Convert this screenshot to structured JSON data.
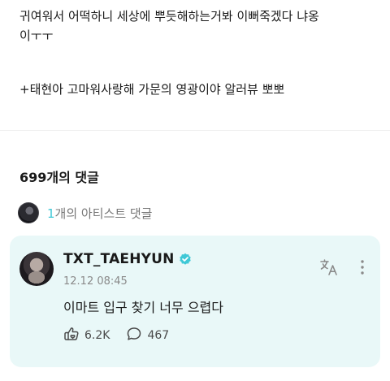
{
  "post": {
    "line1": "귀여워서 어떡하니 세상에 뿌듯해하는거봐 이뻐죽겠다 냐옹",
    "line2": "이ㅜㅜ",
    "addendum": "+태현아 고마워사랑해 가문의 영광이야 알러뷰 뽀뽀"
  },
  "comments": {
    "header": "699개의 댓글"
  },
  "artist_row": {
    "count": "1",
    "label": "개의 아티스트 댓글"
  },
  "artist_comment": {
    "name": "TXT_TAEHYUN",
    "timestamp": "12.12 08:45",
    "text": "이마트 입구 찾기 너무 으렵다",
    "likes": "6.2K",
    "replies": "467",
    "accent_color": "#3ec8d6",
    "card_bg": "#e9f8f8",
    "icons": {
      "verified": "verified-badge-icon",
      "translate": "translate-icon",
      "more": "more-vertical-icon",
      "like": "like-icon",
      "reply": "reply-icon"
    }
  }
}
